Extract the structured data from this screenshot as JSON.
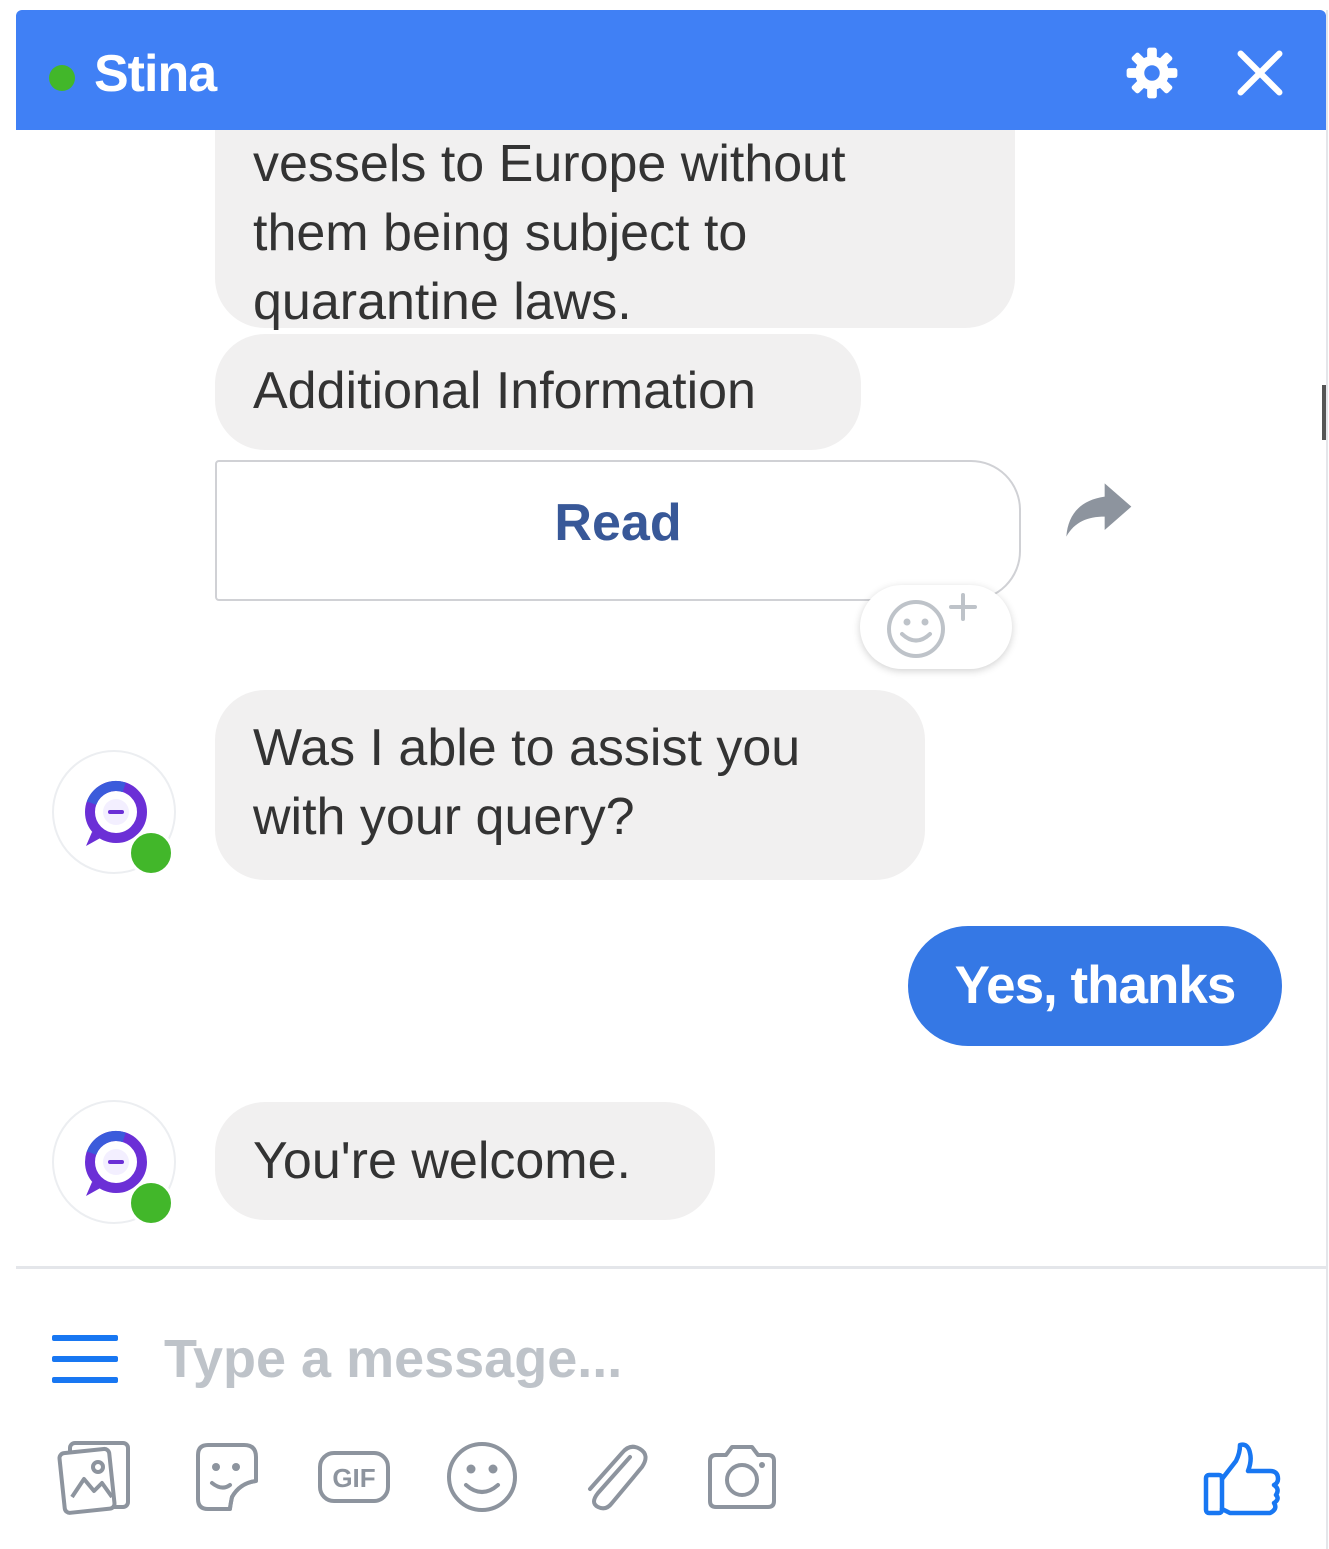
{
  "header": {
    "title": "Stina",
    "presence": "online",
    "settings_icon": "gear-icon",
    "close_icon": "close-icon"
  },
  "messages": {
    "bot_1": {
      "clipped_line": "vessels to Europe without",
      "line_2": "them being subject to",
      "line_3": "quarantine laws."
    },
    "bot_2": "Additional Information",
    "card_button": "Read",
    "bot_3": {
      "line_1": "Was I able to assist you",
      "line_2": "with your query?"
    },
    "user_1": "Yes, thanks",
    "bot_4": "You're welcome."
  },
  "composer": {
    "placeholder": "Type a message...",
    "tools": [
      "photo-icon",
      "sticker-icon",
      "gif-icon",
      "emoji-icon",
      "paperclip-icon",
      "camera-icon"
    ],
    "gif_label": "GIF",
    "send_icon": "thumbs-up-icon"
  },
  "colors": {
    "header_bg": "#4080f5",
    "outgoing_bubble": "#3578e5",
    "incoming_bubble": "#f1f0f0",
    "link_text": "#385898",
    "online": "#42b72a",
    "toolbar_icon": "#8d949e",
    "accent_icon": "#1877f2"
  }
}
